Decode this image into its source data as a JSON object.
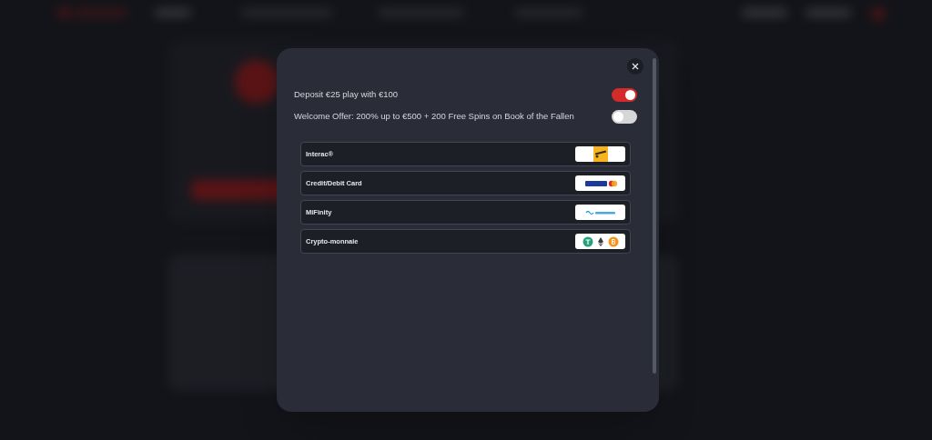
{
  "bonuses": [
    {
      "label": "Deposit €25 play with €100",
      "on": true
    },
    {
      "label": "Welcome Offer: 200% up to €500 + 200 Free Spins on Book of the Fallen",
      "on": false
    }
  ],
  "payment_methods": [
    {
      "name": "Interac®",
      "kind": "interac"
    },
    {
      "name": "Credit/Debit Card",
      "kind": "card"
    },
    {
      "name": "MiFinity",
      "kind": "mifinity"
    },
    {
      "name": "Crypto-monnaie",
      "kind": "crypto"
    }
  ]
}
